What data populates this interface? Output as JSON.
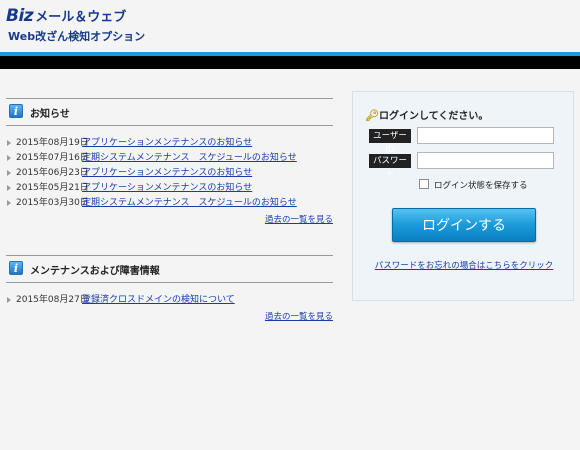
{
  "header": {
    "logo_brand": "Biz",
    "logo_service": "メール＆ウェブ",
    "subtitle": "Web改ざん検知オプション"
  },
  "news": {
    "title": "お知らせ",
    "items": [
      {
        "date": "2015年08月19日",
        "text": "アプリケーションメンテナンスのお知らせ"
      },
      {
        "date": "2015年07月16日",
        "text": "定期システムメンテナンス　スケジュールのお知らせ"
      },
      {
        "date": "2015年06月23日",
        "text": "アプリケーションメンテナンスのお知らせ"
      },
      {
        "date": "2015年05月21日",
        "text": "アプリケーションメンテナンスのお知らせ"
      },
      {
        "date": "2015年03月30日",
        "text": "定期システムメンテナンス　スケジュールのお知らせ"
      }
    ],
    "more": "過去の一覧を見る"
  },
  "maintenance": {
    "title": "メンテナンスおよび障害情報",
    "items": [
      {
        "date": "2015年08月27日",
        "text": "登録済クロスドメインの検知について"
      }
    ],
    "more": "過去の一覧を見る"
  },
  "login": {
    "heading": "ログインしてください。",
    "user_label": "ユーザーID",
    "user_value": "",
    "pass_label": "パスワード",
    "pass_value": "",
    "remember_label": "ログイン状態を保存する",
    "remember_checked": false,
    "button": "ログインする",
    "forgot": "パスワードをお忘れの場合はこちらをクリック"
  },
  "icons": {
    "info": "info-icon",
    "key": "key-icon",
    "bullet": "triangle-bullet-icon"
  },
  "colors": {
    "brand": "#173a8c",
    "accent_bar": "#1a9ad8",
    "link": "#1a3ca8",
    "button": "#1b9ad9"
  }
}
